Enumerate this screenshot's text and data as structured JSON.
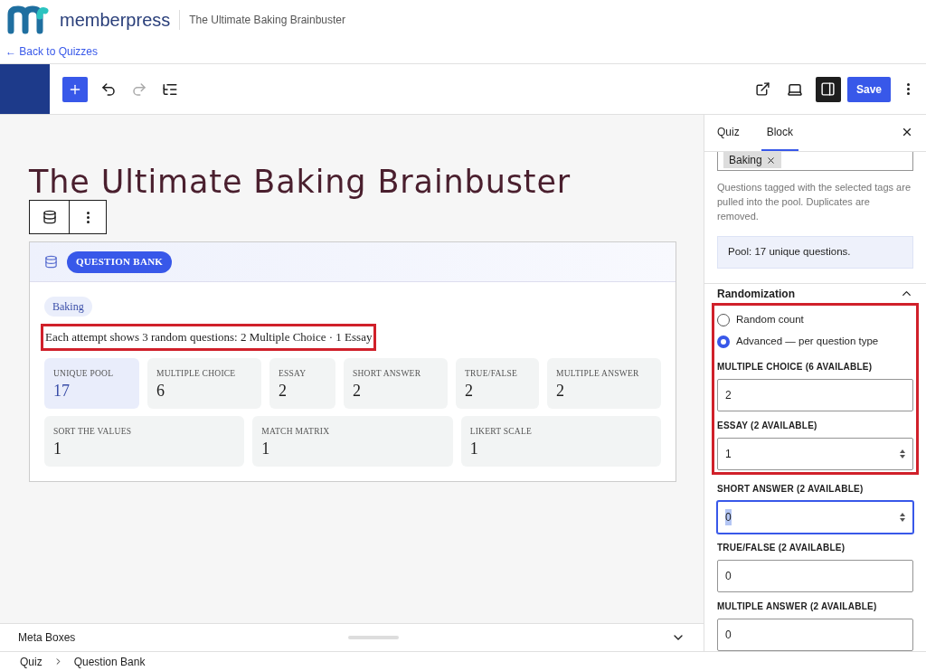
{
  "header": {
    "logo_text": "memberpress",
    "page_title": "The Ultimate Baking Brainbuster",
    "back_link": "← Back to Quizzes"
  },
  "toolbar": {
    "save_label": "Save",
    "settings_open": true
  },
  "block": {
    "title": "The Ultimate Baking Brainbuster",
    "badge": "QUESTION BANK",
    "tags": [
      "Baking"
    ],
    "summary": "Each attempt shows 3 random questions: 2 Multiple Choice · 1 Essay",
    "summary_annotated": true,
    "stat_rows": [
      [
        {
          "label": "UNIQUE POOL",
          "value": "17",
          "highlighted": true
        },
        {
          "label": "MULTIPLE CHOICE",
          "value": "6",
          "highlighted": false
        },
        {
          "label": "ESSAY",
          "value": "2",
          "highlighted": false
        },
        {
          "label": "SHORT ANSWER",
          "value": "2",
          "highlighted": false
        },
        {
          "label": "TRUE/FALSE",
          "value": "2",
          "highlighted": false
        },
        {
          "label": "MULTIPLE ANSWER",
          "value": "2",
          "highlighted": false
        }
      ],
      [
        {
          "label": "SORT THE VALUES",
          "value": "1",
          "highlighted": false
        },
        {
          "label": "MATCH MATRIX",
          "value": "1",
          "highlighted": false
        },
        {
          "label": "LIKERT SCALE",
          "value": "1",
          "highlighted": false
        }
      ]
    ]
  },
  "sidebar": {
    "tabs": [
      {
        "label": "Quiz",
        "selected": false
      },
      {
        "label": "Block",
        "selected": true
      }
    ],
    "tags": [
      "Baking"
    ],
    "help": "Questions tagged with the selected tags are pulled into the pool. Duplicates are removed.",
    "pool_notice": "Pool: 17 unique questions.",
    "section": {
      "title": "Randomization",
      "expanded": true
    },
    "modes": [
      {
        "label": "Random count",
        "selected": false
      },
      {
        "label": "Advanced — per question type",
        "selected": true
      }
    ],
    "fields": [
      {
        "label": "MULTIPLE CHOICE (6 AVAILABLE)",
        "value": "2",
        "focused": false,
        "stepper": false,
        "annotated": true
      },
      {
        "label": "ESSAY (2 AVAILABLE)",
        "value": "1",
        "focused": false,
        "stepper": true,
        "annotated": true
      },
      {
        "label": "SHORT ANSWER (2 AVAILABLE)",
        "value": "0",
        "focused": true,
        "stepper": true,
        "annotated": false
      },
      {
        "label": "TRUE/FALSE (2 AVAILABLE)",
        "value": "0",
        "focused": false,
        "stepper": false,
        "annotated": false
      },
      {
        "label": "MULTIPLE ANSWER (2 AVAILABLE)",
        "value": "0",
        "focused": false,
        "stepper": false,
        "annotated": false
      }
    ]
  },
  "meta_boxes": {
    "label": "Meta Boxes",
    "expanded": false
  },
  "breadcrumb": [
    "Quiz",
    "Question Bank"
  ]
}
